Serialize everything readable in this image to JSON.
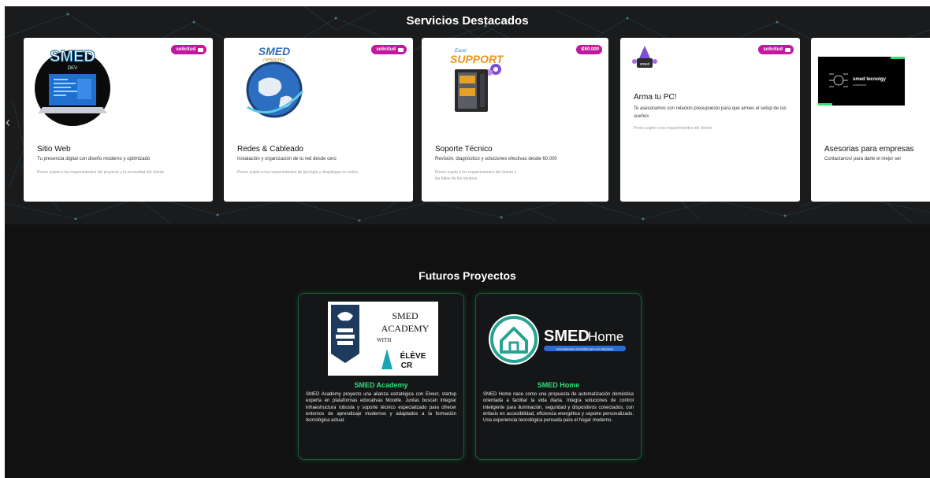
{
  "services": {
    "title": "Servicios Destacados",
    "cards": [
      {
        "badge": "solicitud",
        "title": "Sitio Web",
        "desc": "Tu presencia digital con diseño moderno y optimizado",
        "note": "Precio sujeto a los requerimientos del proyecto y la necesidad del cliente",
        "logo_text": "SMED",
        "logo_sub": "DEV"
      },
      {
        "badge": "solicitud",
        "title": "Redes & Cableado",
        "desc": "Instalación y organización de tu red desde cero",
        "note": "Precio sujeto a los requerimientos de tipología y despliegue en redes.",
        "logo_text": "SMED",
        "logo_sub": "networks"
      },
      {
        "badge": "₡60.000",
        "title": "Soporte Técnico",
        "desc": "Revisión, diagnóstico y soluciones efectivas desde 60.000",
        "note": "Precio sujeto a los requerimientos del cliente y\nlas fallas de los equipos",
        "logo_text": "SUPPORT",
        "logo_sub": "Excel"
      },
      {
        "badge": "solicitud",
        "title": "Arma tu PC!",
        "desc": "Te asesoramos con relacion presupuesto para que armes el setup de tus sueños",
        "note": "Precio sujeto a los requerimientos del cliente",
        "logo_text": "smed"
      },
      {
        "badge": "",
        "title": "Asesorias para empresas",
        "desc": "Contactanos! para darte el mejor ser",
        "note": "",
        "logo_text": "smed tecnolgy",
        "logo_sub": "consultoria"
      }
    ]
  },
  "projects": {
    "title": "Futuros Proyectos",
    "items": [
      {
        "title": "SMED Academy",
        "logo_lines": [
          "SMED",
          "ACADEMY"
        ],
        "logo_with": "WITH",
        "logo_partner": "ÉLÈVE",
        "logo_partner_sub": "CR",
        "desc": "SMED Academy proyecto una alianza estratégica con Elvecr, startup experta en plataformas educativas Moodle. Juntas buscan integrar infraestructura robusta y soporte técnico especializado para ofrecer entornos de aprendizaje modernos y adaptados a la formación tecnológica actual."
      },
      {
        "title": "SMED Home",
        "logo_bold": "SMED",
        "logo_light": "Home",
        "logo_tagline": "automatización doméstica para una vida plena",
        "desc": "SMED Home nace como una propuesta de automatización doméstica orientada a facilitar la vida diaria. Integra soluciones de control inteligente para iluminación, seguridad y dispositivos conectados, con énfasis en accesibilidad, eficiencia energética y soporte personalizado. Una experiencia tecnológica pensada para el hogar moderno."
      }
    ]
  },
  "nav": {
    "prev": "‹",
    "next": "›"
  },
  "colors": {
    "badge": "#c2179f",
    "project_title": "#2ee079",
    "dark_bg": "#1a1b1c"
  }
}
